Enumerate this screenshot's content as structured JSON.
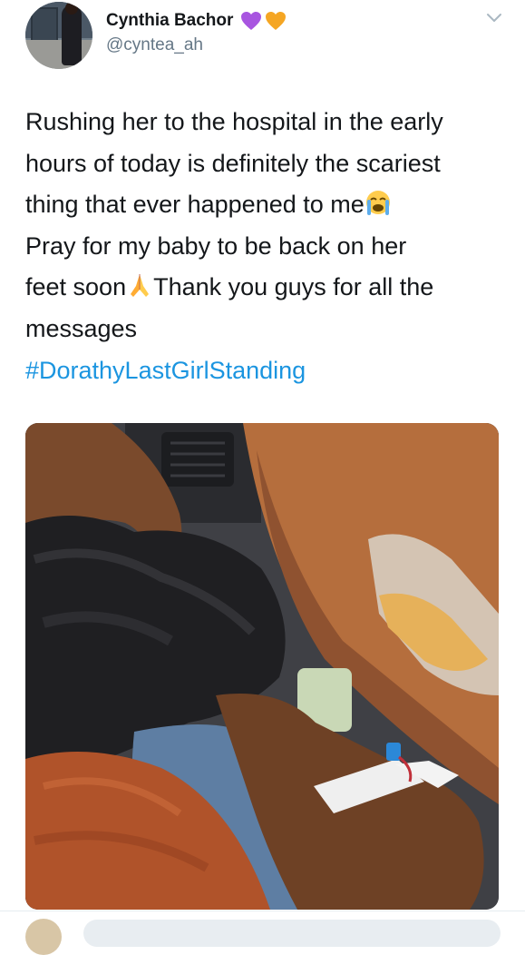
{
  "user": {
    "display_name": "Cynthia Bachor",
    "handle": "@cyntea_ah",
    "badges": [
      "purple-heart-icon",
      "orange-heart-icon"
    ],
    "avatar": "avatar"
  },
  "tweet": {
    "text_lines": [
      "Rushing her to the hospital in the early",
      "hours of today is definitely the scariest",
      "thing that ever happened to me",
      "Pray for my baby to be back on her",
      "feet soon",
      "Thank you guys for all the",
      "messages"
    ],
    "hashtag": "#DorathyLastGirlStanding",
    "emojis": [
      "loudly-crying-face-icon",
      "folded-hands-icon"
    ],
    "media": "photo of a hand with an IV cannula inside a car"
  },
  "colors": {
    "text": "#14171a",
    "secondary": "#657786",
    "link": "#1b95e0",
    "purple_heart": "#a855e0",
    "orange_heart": "#f5a623"
  }
}
